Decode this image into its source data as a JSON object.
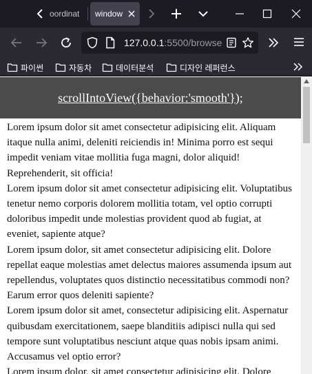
{
  "browser": {
    "tabs": [
      {
        "label": "oordinat",
        "active": false
      },
      {
        "label": "window",
        "active": true
      }
    ],
    "url": {
      "host": "127.0.0.1",
      "rest": ":5500/browse"
    },
    "bookmarks": [
      {
        "label": "파이썬"
      },
      {
        "label": "자동차"
      },
      {
        "label": "데이터분석"
      },
      {
        "label": "디자인 레퍼런스"
      }
    ],
    "colors": {
      "tabstrip_bg": "#1c1b22",
      "toolbar_bg": "#2b2a33",
      "active_tab_bg": "#42414d",
      "icon": "#fbfbfe"
    }
  },
  "page": {
    "title": "scrollIntoView({behavior:'smooth'});",
    "header_bg": "#4b4b4b",
    "paragraphs": [
      "Lorem ipsum dolor sit amet consectetur adipisicing elit. Aliquam itaque nulla animi, deleniti reiciendis in! Minima porro est sequi impedit veniam vitae mollitia fuga magni, dolor aliquid! Reprehenderit, sit officia!",
      "Lorem ipsum dolor sit amet consectetur adipisicing elit. Voluptatibus tenetur nemo corporis dolorem mollitia totam, vel optio corrupti doloribus impedit unde molestias provident quod ab fugiat, at eveniet, sapiente atque?",
      "Lorem ipsum dolor, sit amet consectetur adipisicing elit. Dolore repellat eaque molestias amet delectus maiores assumenda ipsum aut repellendus, voluptates quos distinctio necessitatibus commodi non? Earum error quos deleniti sapiente?",
      "Lorem ipsum dolor sit amet, consectetur adipisicing elit. Aspernatur quibusdam exercitationem, saepe blanditiis adipisci nulla qui sed tempore sunt voluptatibus nesciunt atque quas nobis ipsam animi. Accusamus vel optio error?",
      "Lorem ipsum dolor, sit amet consectetur adipisicing elit. Dolore"
    ]
  }
}
